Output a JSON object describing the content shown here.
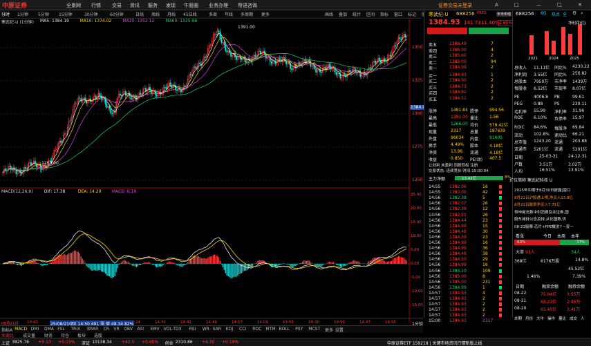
{
  "app": {
    "logo_text": "中原证券",
    "menus": [
      "全景网",
      "行情",
      "交易",
      "资讯",
      "服务",
      "发现",
      "牛股圈",
      "业务办理",
      "帮语咨询"
    ],
    "promo": "证券交易未登录",
    "window_controls": [
      "A",
      "□",
      "—",
      "□",
      "✕"
    ]
  },
  "toolbar": {
    "periods": [
      "分时",
      "1分钟",
      "5分钟",
      "15分钟",
      "30分钟",
      "60分钟",
      "日线",
      "周线",
      "月线",
      "45日线",
      "多周",
      "年线",
      "多周期",
      "更多"
    ],
    "right_tools": [
      "画线",
      "叠加",
      "统计",
      "区间",
      "指标",
      "窗口",
      "标记",
      "股",
      "标签",
      "自选",
      "设置"
    ]
  },
  "chart": {
    "title": "寒武纪-U (1分钟)",
    "ma_legend": [
      {
        "text": "MA5: 1384.19",
        "color": "#e8e8e8"
      },
      {
        "text": "MA10: 1374.02",
        "color": "#ffd400"
      },
      {
        "text": "MA20: 1352.12",
        "color": "#e040e0"
      },
      {
        "text": "MA60: 1325.68",
        "color": "#19d36a"
      }
    ],
    "peak_label": "1391.00",
    "low_label": "1253.00",
    "current_price_tag": "1384.93",
    "price_axis": [
      "1350",
      "1325",
      "1300",
      "1275",
      "1250"
    ],
    "macd_legend": [
      {
        "text": "MACD(12,26,9)",
        "color": "#c8c8c8"
      },
      {
        "text": "DIF: 17.38",
        "color": "#e8e8e8"
      },
      {
        "text": "DEA: 14.29",
        "color": "#ffd400"
      },
      {
        "text": "MACD: 6.18",
        "color": "#e040e0"
      }
    ],
    "macd_axis": [
      "25.00",
      "20.00",
      "15.00",
      "10.00",
      "5.00",
      "0.00",
      "-5.00",
      "-10.00",
      "-15.00"
    ],
    "time_axis": [
      "08月21日",
      "13:43",
      "13:51",
      "14:07",
      "14:16",
      "14:24",
      "14:32",
      "14:41",
      "14:49",
      "14:57",
      "14:09",
      "13:53",
      "10:30",
      "10:50",
      "14:47",
      "14:55"
    ],
    "cursor_info": "25/08/21(四) 14:50 491 涨 值 48.34 82%",
    "period_btn": "1分钟"
  },
  "indicator_tabs": [
    "指标A",
    "MACD",
    "DMI",
    "DMA",
    "FSL",
    "TRIX",
    "BRAR",
    "CR",
    "VR",
    "OBV",
    "ASI",
    "EMV",
    "VOL-TDX",
    "RSI",
    "WR",
    "SAR",
    "KDJ",
    "CCI",
    "ROC",
    "MTM",
    "BOLL",
    "PSY",
    "MCST",
    "更多",
    "设置"
  ],
  "sub_tabs": [
    "大周比",
    "成交量",
    "财务",
    "持仓",
    "板块",
    "选股"
  ],
  "quote": {
    "name": "寒武纪-U",
    "code": "688256",
    "tag": "KR83",
    "btn_halfday": "半半年线",
    "price": "1384.93",
    "change": "141.73",
    "pct": "11.40%",
    "pct2": "2.65%",
    "asks": [
      {
        "label": "卖五",
        "price": "1386.49",
        "vol": "7"
      },
      {
        "label": "卖四",
        "price": "1386.00",
        "vol": "4"
      },
      {
        "label": "卖三",
        "price": "1385.60",
        "vol": "2"
      },
      {
        "label": "卖二",
        "price": "1385.00",
        "vol": "94"
      },
      {
        "label": "卖一",
        "price": "1384.99",
        "vol": "2"
      }
    ],
    "bids": [
      {
        "label": "买一",
        "price": "1384.93",
        "vol": "1"
      },
      {
        "label": "买二",
        "price": "1384.90",
        "vol": "2"
      },
      {
        "label": "买三",
        "price": "1384.73",
        "vol": "2"
      },
      {
        "label": "买四",
        "price": "1384.52",
        "vol": "2"
      },
      {
        "label": "买五",
        "price": "1384.51",
        "vol": "2"
      }
    ],
    "stats": [
      {
        "l": "涨停",
        "v": "1491.84",
        "l2": "跌停",
        "v2": "994.56"
      },
      {
        "l": "最高",
        "v": "1391.00",
        "l2": "量比",
        "v2": "1.56"
      },
      {
        "l": "最低",
        "v": "1266.00",
        "l2": "均价",
        "v2": "579.42亿"
      },
      {
        "l": "现量",
        "v": "2317",
        "l2": "总量",
        "v2": "187639"
      },
      {
        "l": "外盘",
        "v": "96034",
        "l2": "内盘",
        "v2": "91605"
      },
      {
        "l": "换手",
        "v": "4.49%",
        "l2": "股本",
        "v2": "4.18亿"
      },
      {
        "l": "净资",
        "v": "13.96",
        "l2": "流通",
        "v2": "4.18亿"
      },
      {
        "l": "收益",
        "v": "0.850",
        "l2": "PE(动)",
        "v2": "407.5"
      }
    ],
    "note1": "让创利 未盈利 同股同权 注册",
    "note2": "交易状态: 连续竞价 时间:15:00:04",
    "main_flow_label": "主力净额",
    "main_flow_val": "13.42亿",
    "main_flow_pct": "8%",
    "ticks": [
      [
        "14:55",
        "1382.06",
        "16",
        "R"
      ],
      [
        "14:55",
        "1383.00",
        "42",
        "R"
      ],
      [
        "14:56",
        "1382.38",
        "5",
        "G"
      ],
      [
        "14:56",
        "1382.07",
        "26",
        "R"
      ],
      [
        "14:56",
        "1382.38",
        "12",
        "R"
      ],
      [
        "14:56",
        "1382.55",
        "26",
        "R"
      ],
      [
        "14:56",
        "1384.44",
        "23",
        "R"
      ],
      [
        "14:56",
        "1384.99",
        "15",
        "R"
      ],
      [
        "14:56",
        "1384.48",
        "30",
        "R"
      ],
      [
        "14:56",
        "1384.59",
        "23",
        "R"
      ],
      [
        "14:56",
        "1384.99",
        "16",
        "R"
      ],
      [
        "14:56",
        "1384.99",
        "36",
        "R"
      ],
      [
        "14:56",
        "1384.48",
        "38",
        "R"
      ],
      [
        "14:56",
        "1384.50",
        "29",
        "R"
      ],
      [
        "14:56",
        "1384.99",
        "16",
        "R"
      ],
      [
        "14:56",
        "1384.10",
        "109",
        "G"
      ],
      [
        "14:56",
        "1385.00",
        "8",
        "R"
      ],
      [
        "14:56",
        "1385.00",
        "231",
        "R"
      ],
      [
        "14:56",
        "1384.99",
        "1",
        "G"
      ],
      [
        "14:57",
        "1384.93",
        "4",
        "R"
      ],
      [
        "14:57",
        "1384.93",
        "2",
        "R"
      ],
      [
        "14:57",
        "1384.93",
        "2",
        "R"
      ],
      [
        "14:57",
        "1384.93",
        "2",
        "R"
      ],
      [
        "14:57",
        "1384.93",
        "2",
        "R"
      ]
    ],
    "last_tick": [
      "15:00",
      "1384.93",
      "2317",
      "R"
    ]
  },
  "fin": {
    "code": "688256",
    "badges": [
      "6G",
      "热点",
      "全"
    ],
    "bar_years": [
      "2021",
      "2024",
      "2025"
    ],
    "bar_caption": "净利润(亿)",
    "rows": [
      {
        "l": "总收入",
        "v": "11.11亿",
        "l2": "同比%",
        "v2": "4230.22"
      },
      {
        "l": "净利润",
        "v": "3.55亿",
        "l2": "同比%",
        "v2": "256.82"
      },
      {
        "l": "总股本",
        "v": "7950万",
        "l2": "市净率",
        "v2": "1439万"
      },
      {
        "l": "每股收",
        "v": "6.52亿",
        "l2": "市现率",
        "v2": "8.07亿"
      },
      {
        "l": "PE",
        "v": "4006.8",
        "l2": "PB",
        "v2": "99.61"
      },
      {
        "l": "PEG",
        "v": "0.88",
        "l2": "PS",
        "v2": "230.11"
      },
      {
        "l": "毛利率",
        "v": "55.99",
        "l2": "净利率",
        "v2": "31.96"
      },
      {
        "l": "ROE",
        "v": "6.10%",
        "l2": "负债率",
        "v2": "15.97"
      },
      {
        "l": "ROIC",
        "v": "84.6%",
        "l2": "每股净",
        "v2": "69.84"
      },
      {
        "l": "流动",
        "v": "102.8%",
        "l2": "速动比",
        "v2": "66.21"
      },
      {
        "l": "总市值",
        "v": "1243.20",
        "l2": "流通",
        "v2": "203.88"
      },
      {
        "l": "流通市",
        "v": "5201亿",
        "l2": "流通",
        "v2": "5201亿"
      }
    ],
    "dates": [
      {
        "l": "日期",
        "v": "25-03-31",
        "l2": "",
        "v2": "24-12-31"
      },
      {
        "l": "户数",
        "v": "3.51万",
        "l2": "",
        "v2": "3.02万"
      },
      {
        "l": "人均",
        "v": "16.51%",
        "l2": "",
        "v2": "13.91%"
      }
    ],
    "news_header": "扩位简称 寒武纪科技 U",
    "news": [
      "2025年中期于8月30日披露[窗口",
      "8月22日沪股通上榜,净买入13.8亿",
      "8月22日融资净买入7.71亿",
      "恒申闽光数中供消费及业证券,国",
      "股东减持公告及持,从化国数,供",
      "08-22股票-芯片+FPE概念↑~变一"
    ],
    "sentiment_label": "看涨",
    "sentiment_tabs": [
      "今日",
      "本周",
      "本年"
    ],
    "sentiment_left": "63%",
    "sentiment_right": "37%",
    "big_label": "大单",
    "sell_big": "93人",
    "buy_big": "34人",
    "turnover1": "368亿",
    "turnover1b": "6176万股",
    "turnover1c": "14.8%",
    "turnover2": "45.52亿",
    "ratio1": "1.46%",
    "ratio1b": "7.39%",
    "table_head": [
      "日期",
      "融资余额",
      "融券余额"
    ],
    "table": [
      [
        "08-22",
        "75.94亿",
        "3.55万"
      ],
      [
        "08-21",
        "68.23亿",
        "2.45万"
      ],
      [
        "08-20",
        "65.45亿",
        "3.41万"
      ]
    ],
    "footer_tabs": [
      "本期",
      "月份",
      "大牛",
      "操作",
      "量比",
      "成交",
      "人"
    ]
  },
  "status": {
    "items": [
      "上证",
      "3825.76",
      "+5.13",
      "+0.15%",
      "深证",
      "10138.34",
      "+42.5",
      "+0.45%",
      "创业",
      "2310.86",
      "+4.35",
      "+0.19%"
    ],
    "right": "中原证券ETF 159218 | 关键市场资讯行情新版上线"
  }
}
